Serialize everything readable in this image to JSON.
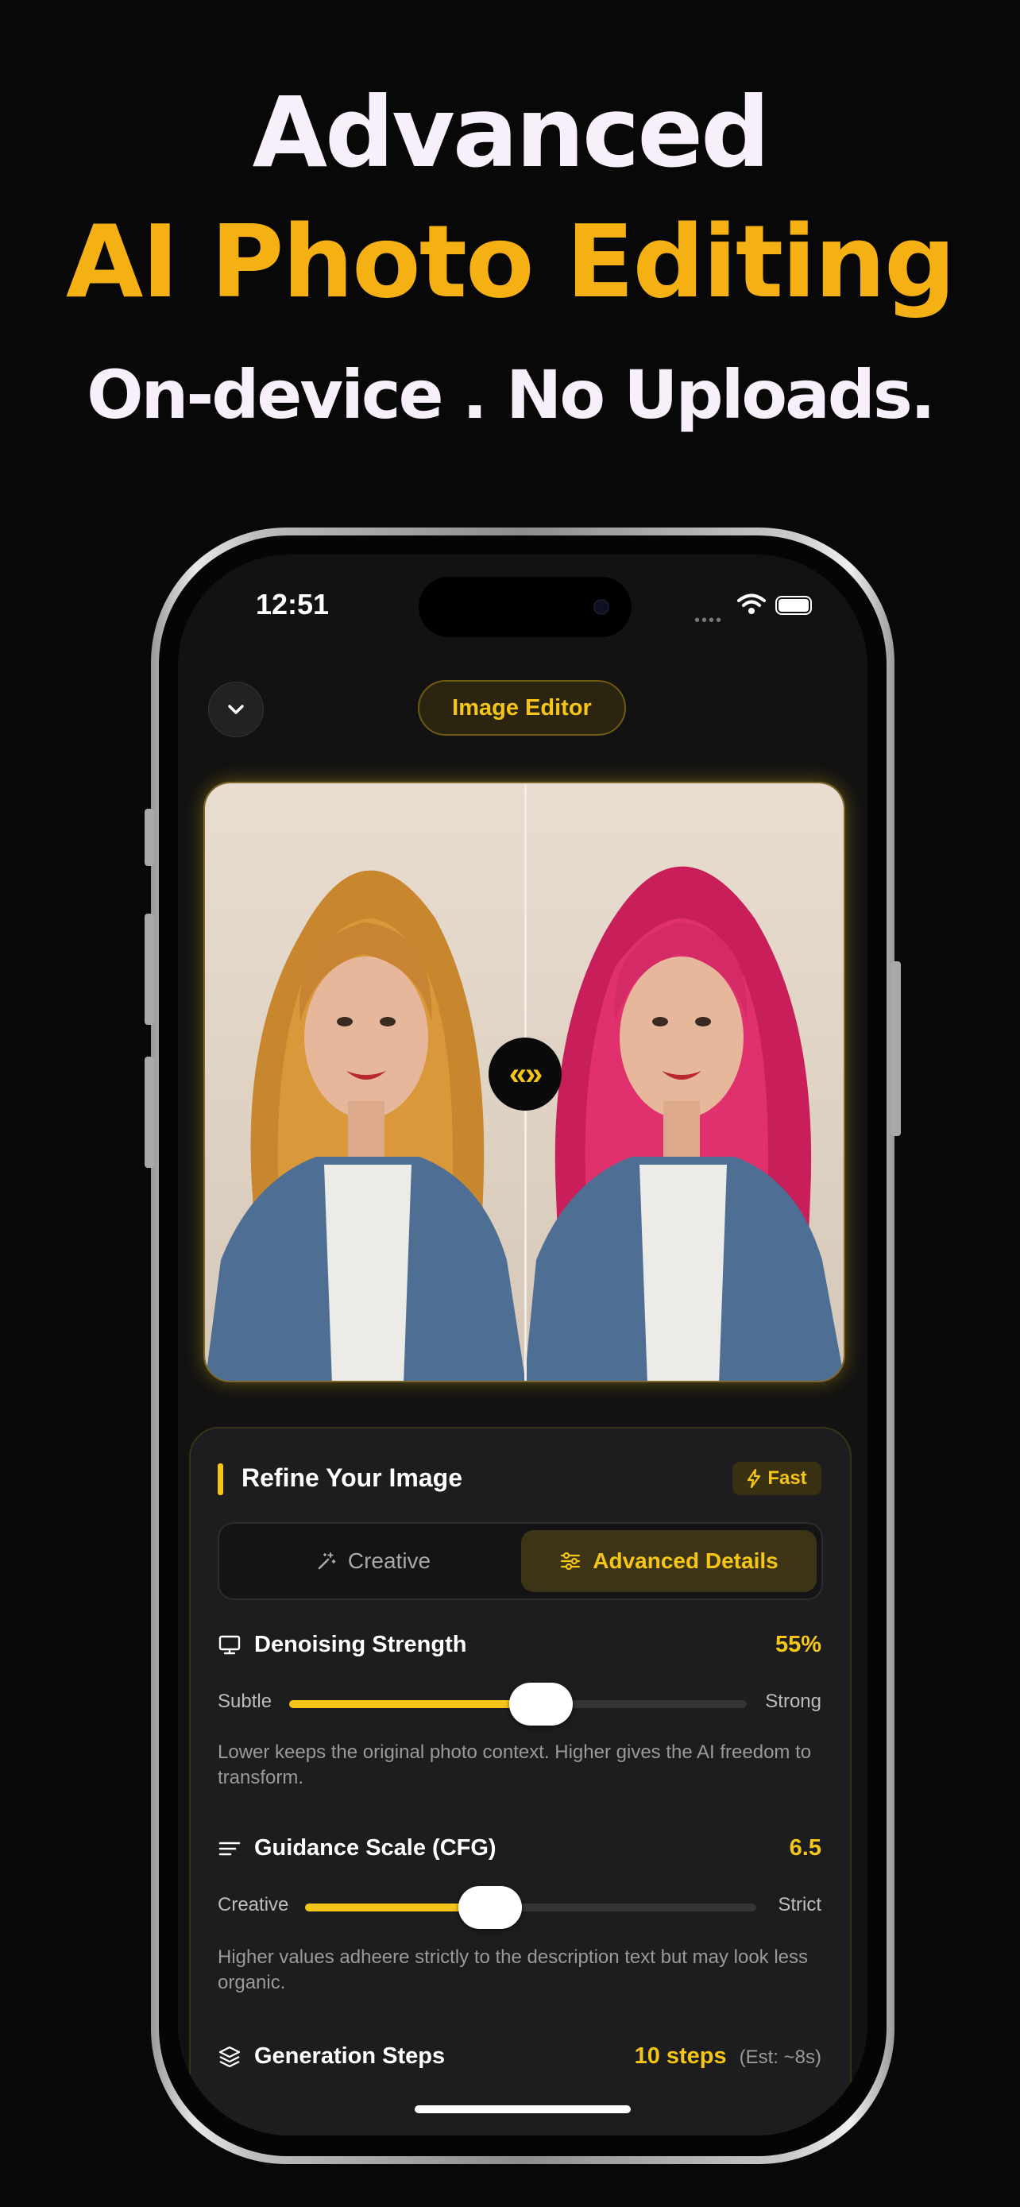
{
  "headline": {
    "line1": "Advanced",
    "line2": "AI Photo Editing",
    "line3": "On-device . No Uploads."
  },
  "status_bar": {
    "time": "12:51",
    "signal_dots": "••••"
  },
  "header": {
    "title": "Image Editor",
    "back_icon": "chevron-down-icon"
  },
  "compare": {
    "handle_glyph": "«»",
    "handle_icon": "compare-arrows-icon"
  },
  "panel": {
    "title": "Refine Your Image",
    "badge": "Fast",
    "tabs": [
      {
        "label": "Creative",
        "icon": "magic-wand-icon",
        "selected": false
      },
      {
        "label": "Advanced Details",
        "icon": "sliders-icon",
        "selected": true
      }
    ],
    "denoising": {
      "label": "Denoising Strength",
      "value": "55%",
      "level": 0.55,
      "min_label": "Subtle",
      "max_label": "Strong",
      "description": "Lower keeps the original photo context. Higher gives the AI freedom to transform."
    },
    "guidance": {
      "label": "Guidance Scale (CFG)",
      "value": "6.5",
      "level": 0.41,
      "min_label": "Creative",
      "max_label": "Strict",
      "description": "Higher values adheere strictly to the description text but may look less organic."
    },
    "steps": {
      "label": "Generation Steps",
      "value": "10 steps",
      "estimate": "(Est: ~8s)"
    }
  },
  "colors": {
    "accent": "#f5c518",
    "headline_yellow": "#f5b014",
    "background": "#080808"
  }
}
